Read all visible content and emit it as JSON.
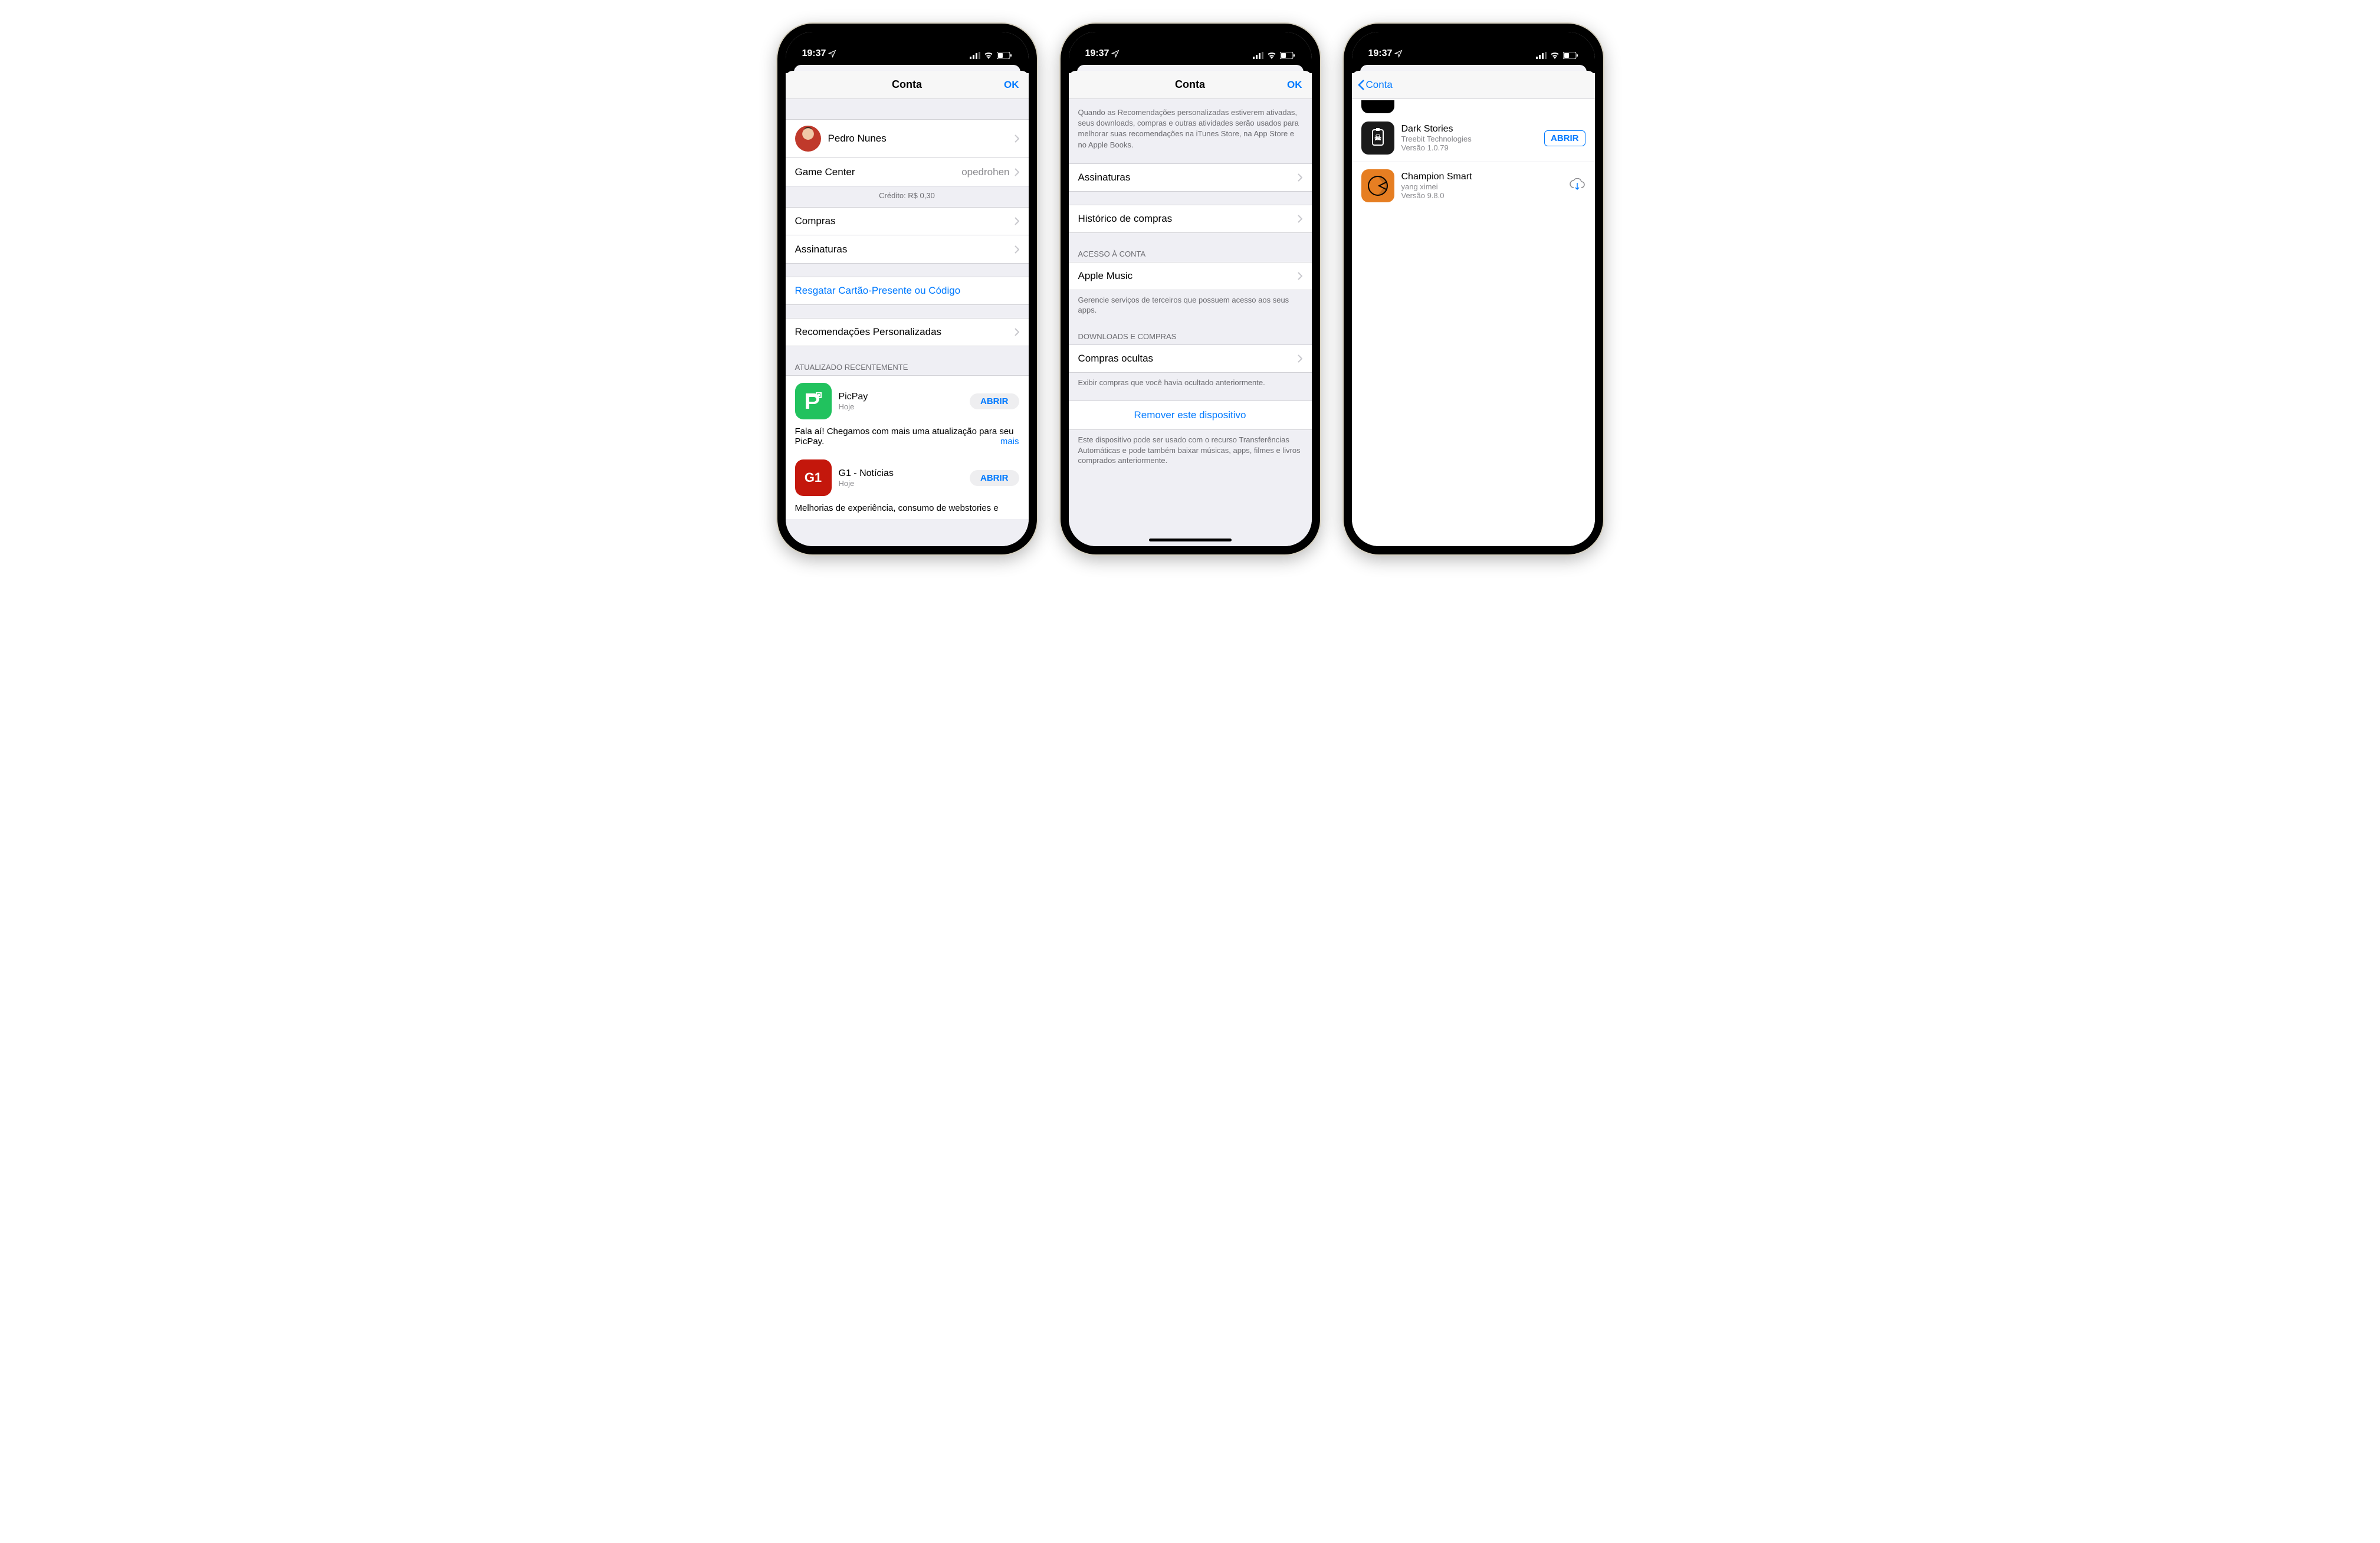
{
  "statusbar": {
    "time": "19:37"
  },
  "phone1": {
    "nav_title": "Conta",
    "nav_ok": "OK",
    "profile_name": "Pedro Nunes",
    "gamecenter_label": "Game Center",
    "gamecenter_value": "opedrohen",
    "credit": "Crédito: R$ 0,30",
    "menu_compras": "Compras",
    "menu_assinaturas": "Assinaturas",
    "menu_resgatar": "Resgatar Cartão-Presente ou Código",
    "menu_recomend": "Recomendações Personalizadas",
    "section_updated": "ATUALIZADO RECENTEMENTE",
    "apps": [
      {
        "name": "PicPay",
        "sub": "Hoje",
        "btn": "ABRIR",
        "note": "Fala aí! Chegamos com mais uma atualização para seu PicPay.",
        "more": "mais"
      },
      {
        "name": "G1 - Notícias",
        "sub": "Hoje",
        "btn": "ABRIR",
        "note": "Melhorias de experiência, consumo de webstories e"
      }
    ]
  },
  "phone2": {
    "nav_title": "Conta",
    "nav_ok": "OK",
    "top_desc": "Quando as Recomendações personalizadas estiverem ativadas, seus downloads, compras e outras atividades serão usados para melhorar suas recomendações na iTunes Store, na App Store e no Apple Books.",
    "row_assinaturas": "Assinaturas",
    "row_historico": "Histórico de compras",
    "section_acesso": "ACESSO À CONTA",
    "row_applemusic": "Apple Music",
    "footer_acesso": "Gerencie serviços de terceiros que possuem acesso aos seus apps.",
    "section_downloads": "DOWNLOADS E COMPRAS",
    "row_ocultas": "Compras ocultas",
    "footer_ocultas": "Exibir compras que você havia ocultado anteriormente.",
    "remove": "Remover este dispositivo",
    "footer_remove": "Este dispositivo pode ser usado com o recurso Transferências Automáticas e pode também baixar músicas, apps, filmes e livros comprados anteriormente."
  },
  "phone3": {
    "nav_back": "Conta",
    "apps": [
      {
        "name": "Dark Stories",
        "dev": "Treebit Technologies",
        "ver": "Versão 1.0.79",
        "btn": "ABRIR"
      },
      {
        "name": "Champion Smart",
        "dev": "yang ximei",
        "ver": "Versão 9.8.0"
      }
    ]
  }
}
